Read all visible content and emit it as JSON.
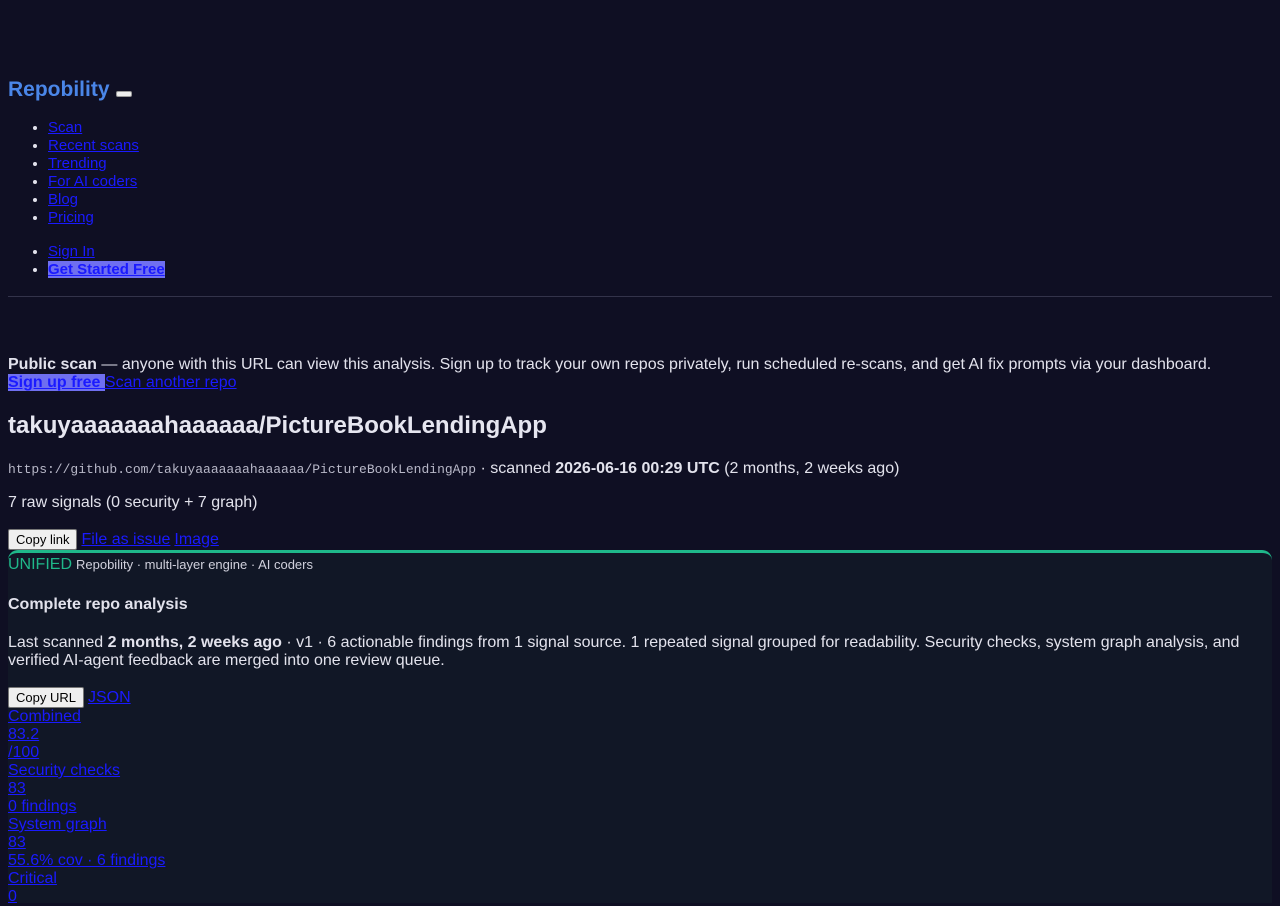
{
  "header": {
    "logo": "Repobility",
    "nav": [
      "Scan",
      "Recent scans",
      "Trending",
      "For AI coders",
      "Blog",
      "Pricing"
    ],
    "sign_in": "Sign In",
    "get_started": "Get Started Free"
  },
  "notice": {
    "bold": "Public scan",
    "text": " — anyone with this URL can view this analysis. Sign up to track your own repos privately, run scheduled re-scans, and get AI fix prompts via your dashboard.",
    "signup": "Sign up free ",
    "scan_another": "Scan another repo"
  },
  "repo": {
    "title": "takuyaaaaaaahaaaaaa/PictureBookLendingApp",
    "url": "https://github.com/takuyaaaaaaahaaaaaa/PictureBookLendingApp",
    "scanned_prefix": " · scanned ",
    "scanned_date": "2026-06-16 00:29 UTC",
    "scanned_relative": " (2 months, 2 weeks ago)",
    "signals": "7 raw signals (0 security + 7 graph)",
    "copy_link": "Copy link",
    "file_issue": "File as issue",
    "image": "Image"
  },
  "card": {
    "tag": "UNIFIED",
    "tag_sub": "Repobility · multi-layer engine · AI coders",
    "title": "Complete repo analysis",
    "summary_prefix": "Last scanned ",
    "summary_bold": "2 months, 2 weeks ago",
    "summary_rest": " · v1 · 6 actionable findings from 1 signal source. 1 repeated signal grouped for readability. Security checks, system graph analysis, and verified AI-agent feedback are merged into one review queue.",
    "copy_url": "Copy URL",
    "json": "JSON",
    "stats": [
      {
        "label": "Combined",
        "value": "83.2",
        "detail": "/100"
      },
      {
        "label": "Security checks",
        "value": "83",
        "detail": "0 findings"
      },
      {
        "label": "System graph",
        "value": "83",
        "detail": "55.6% cov · 6 findings"
      },
      {
        "label": "Critical",
        "value": "0"
      }
    ]
  }
}
